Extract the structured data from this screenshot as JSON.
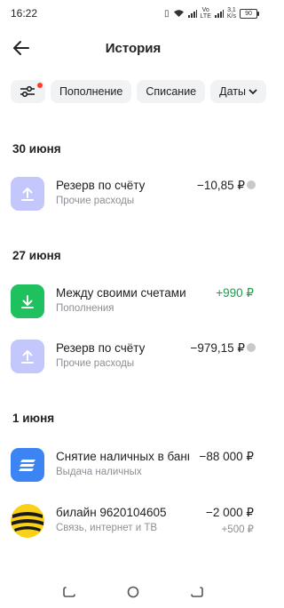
{
  "status": {
    "time": "16:22",
    "net_top": "Vo",
    "net_bottom": "LTE",
    "speed_top": "3,1",
    "speed_bottom": "K/s",
    "battery": "90"
  },
  "header": {
    "title": "История"
  },
  "filters": {
    "income": "Пополнение",
    "expense": "Списание",
    "dates": "Даты"
  },
  "sections": [
    {
      "date": "30 июня",
      "items": [
        {
          "title": "Резерв по счёту",
          "subtitle": "Прочие расходы",
          "amount": "−10,85 ₽"
        }
      ]
    },
    {
      "date": "27 июня",
      "items": [
        {
          "title": "Между своими счетами",
          "subtitle": "Пополнения",
          "amount": "+990 ₽"
        },
        {
          "title": "Резерв по счёту",
          "subtitle": "Прочие расходы",
          "amount": "−979,15 ₽"
        }
      ]
    },
    {
      "date": "1 июня",
      "items": [
        {
          "title": "Снятие наличных в банкомате",
          "subtitle": "Выдача наличных",
          "amount": "−88 000 ₽"
        },
        {
          "title": "билайн 9620104605",
          "subtitle": "Связь, интернет и ТВ",
          "amount": "−2 000 ₽",
          "extra": "+500 ₽"
        }
      ]
    }
  ],
  "colors": {
    "lavender": "#c3c7fb",
    "green": "#1ec15d",
    "blue": "#3c84f4",
    "beeline": "#f9d218",
    "positive": "#1b9e4b"
  }
}
